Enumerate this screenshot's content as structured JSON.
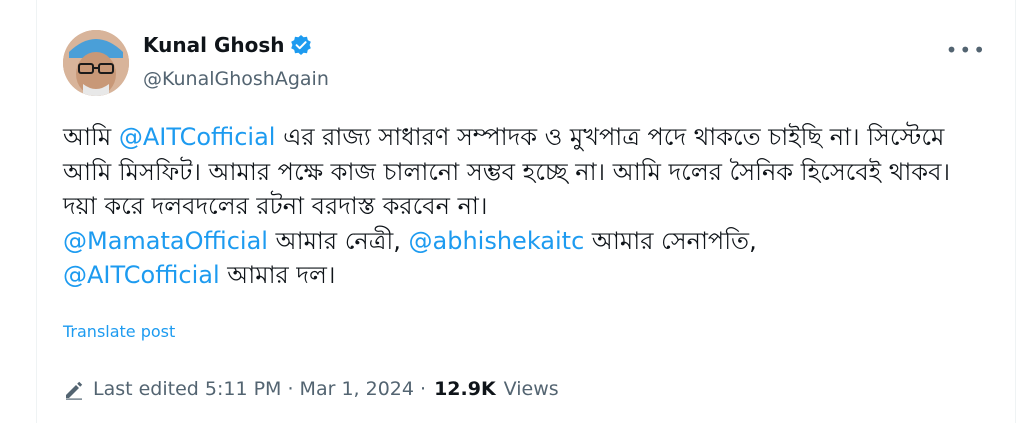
{
  "author": {
    "display_name": "Kunal Ghosh",
    "handle": "@KunalGhoshAgain",
    "verified_icon": "verified-badge-icon",
    "more_icon": "more-options-icon"
  },
  "post": {
    "line1_start": "আমি ",
    "mention_aitc_1": "@AITCofficial",
    "line1_end": " এর রাজ্য সাধারণ সম্পাদক ও মুখপাত্র পদে থাকতে চাইছি না। সিস্টেমে আমি মিসফিট। আমার পক্ষে কাজ চালানো সম্ভব হচ্ছে না।  আমি দলের সৈনিক হিসেবেই থাকব। দয়া করে দলবদলের রটনা বরদাস্ত করবেন না।",
    "mention_mamata": "@MamataOfficial",
    "text_netri": " আমার নেত্রী, ",
    "mention_abhishek": "@abhishekaitc",
    "text_senapati": " আমার সেনাপতি,",
    "mention_aitc_2": "@AITCofficial",
    "text_dal": " আমার দল।"
  },
  "translate_label": "Translate post",
  "meta": {
    "edit_icon": "pencil-icon",
    "edited_label": "Last edited 5:11 PM · Mar 1, 2024 ·",
    "views_count": "12.9K",
    "views_label": "Views"
  },
  "colors": {
    "accent": "#1d9bf0",
    "text": "#0f1419",
    "secondary": "#536471"
  }
}
